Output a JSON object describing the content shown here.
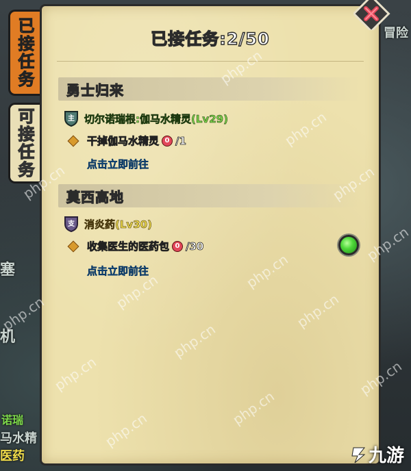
{
  "tabs": [
    {
      "label": "已接任务",
      "active": true
    },
    {
      "label": "可接任务",
      "active": false
    }
  ],
  "panel": {
    "title": "已接任务:2/50"
  },
  "sections": [
    {
      "header": "勇士归来",
      "quest_icon_glyph": "主",
      "quest_name": "切尔诺瑞根:伽马水精灵(Lv29)",
      "objective_text": "干掉伽马水精灵",
      "progress_current": "0",
      "progress_total": "/1",
      "goto_label": "点击立即前往"
    },
    {
      "header": "莫西高地",
      "quest_icon_glyph": "支",
      "quest_name": "消炎药(Lv30)",
      "objective_text": "收集医生的医药包",
      "progress_current": "0",
      "progress_total": "/30",
      "goto_label": "点击立即前往"
    }
  ],
  "background": {
    "fragment_top_right": "冒险",
    "fragment_left_1": "塞",
    "fragment_left_2": "机",
    "fragment_bottom_1": "诺瑞",
    "fragment_bottom_2": "马水精",
    "fragment_bottom_3": "医药"
  },
  "watermark_text": "php.cn",
  "brand": {
    "label": "九游"
  },
  "colors": {
    "tab_active": "#e07c24",
    "parchment": "#ede1ad",
    "link_blue": "#3aa4e8",
    "quest_green": "#7dd84a",
    "quest_yellow": "#f0dc4a"
  }
}
